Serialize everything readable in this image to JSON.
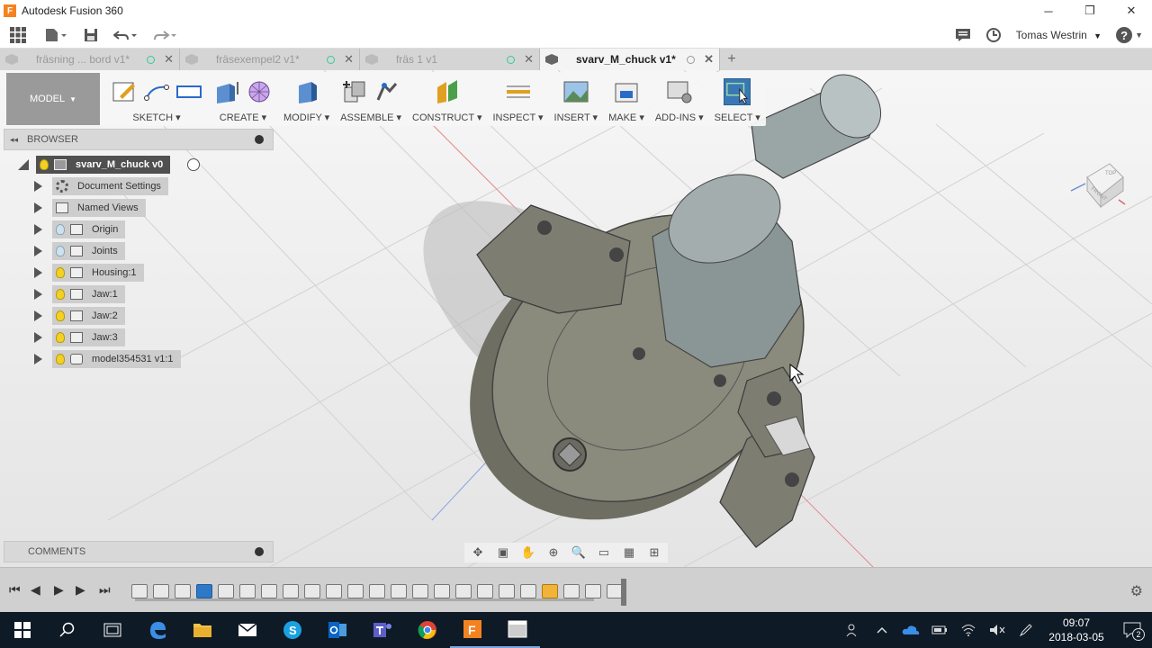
{
  "window": {
    "title": "Autodesk Fusion 360",
    "logo_letter": "F",
    "minimize": "─",
    "restore": "❐",
    "close": "✕"
  },
  "app_toolbar": {
    "user": "Tomas Westrin",
    "user_caret": "▼",
    "help": "?"
  },
  "tabs": [
    {
      "label": "fräsning ... bord v1*",
      "active": false
    },
    {
      "label": "fräsexempel2 v1*",
      "active": false
    },
    {
      "label": "fräs 1 v1",
      "active": false
    },
    {
      "label": "svarv_M_chuck v1*",
      "active": true
    }
  ],
  "tab_add": "+",
  "tab_close": "✕",
  "ribbon": {
    "mode": "MODEL",
    "caret": "▼",
    "groups": [
      {
        "label": "SKETCH"
      },
      {
        "label": "CREATE"
      },
      {
        "label": "MODIFY"
      },
      {
        "label": "ASSEMBLE"
      },
      {
        "label": "CONSTRUCT"
      },
      {
        "label": "INSPECT"
      },
      {
        "label": "INSERT"
      },
      {
        "label": "MAKE"
      },
      {
        "label": "ADD-INS"
      },
      {
        "label": "SELECT"
      }
    ]
  },
  "browser": {
    "title": "BROWSER",
    "collapse": "◂◂",
    "root": "svarv_M_chuck v0",
    "items": [
      {
        "label": "Document Settings",
        "icon": "gear-icon"
      },
      {
        "label": "Named Views",
        "icon": "folder-icon"
      },
      {
        "label": "Origin",
        "icon": "folder-icon",
        "bulb": "off"
      },
      {
        "label": "Joints",
        "icon": "folder-icon",
        "bulb": "off"
      },
      {
        "label": "Housing:1",
        "icon": "component-icon",
        "bulb": "on"
      },
      {
        "label": "Jaw:1",
        "icon": "component-icon",
        "bulb": "on"
      },
      {
        "label": "Jaw:2",
        "icon": "component-icon",
        "bulb": "on"
      },
      {
        "label": "Jaw:3",
        "icon": "component-icon",
        "bulb": "on"
      },
      {
        "label": "model354531 v1:1",
        "icon": "body-icon",
        "bulb": "on"
      }
    ]
  },
  "comments": {
    "title": "COMMENTS"
  },
  "viewcube": {
    "top": "TOP",
    "front": "FRONT"
  },
  "taskbar": {
    "time": "09:07",
    "date": "2018-03-05",
    "notifications": "2"
  },
  "colors": {
    "accent": "#3a78b5",
    "model": "#7a7a6e",
    "taskbar": "#0e1a26"
  }
}
